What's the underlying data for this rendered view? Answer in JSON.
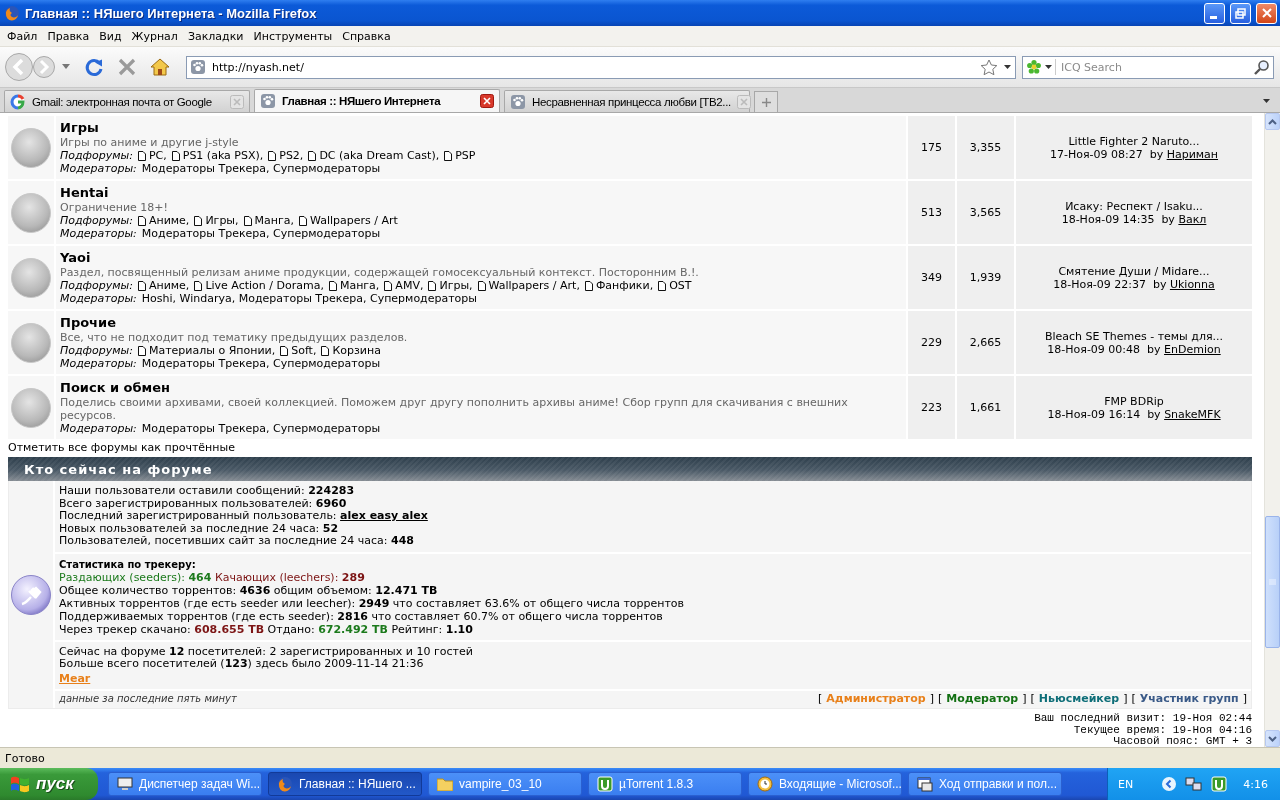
{
  "window": {
    "title": "Главная :: НЯшего Интернета - Mozilla Firefox"
  },
  "menu": [
    "Файл",
    "Правка",
    "Вид",
    "Журнал",
    "Закладки",
    "Инструменты",
    "Справка"
  ],
  "address_bar": {
    "value": "http://nyash.net/"
  },
  "search_bar": {
    "placeholder": "ICQ Search"
  },
  "tabs": [
    {
      "label": "Gmail: электронная почта от Google",
      "selected": false,
      "kind": "google"
    },
    {
      "label": "Главная :: НЯшего Интернета",
      "selected": true,
      "kind": "site"
    },
    {
      "label": "Несравненная принцесса любви [TB2...",
      "selected": false,
      "kind": "site"
    }
  ],
  "forums": [
    {
      "title": "Игры",
      "description": "Игры по аниме и другие j-style",
      "subforums_label": "Подфорумы:",
      "subforums": [
        "PC,",
        "PS1 (aka PSX),",
        "PS2,",
        "DC (aka Dream Cast),",
        "PSP"
      ],
      "moderators_label": "Модераторы:",
      "moderators": "Модераторы Трекера, Супермодераторы",
      "topics": "175",
      "posts": "3,355",
      "last_post": {
        "title": "Little Fighter 2 Naruto...",
        "date": "17-Ноя-09 08:27",
        "by": "by",
        "author": "Нариман"
      }
    },
    {
      "title": "Hentai",
      "description": "Ограничение 18+!",
      "subforums_label": "Подфорумы:",
      "subforums": [
        "Аниме,",
        "Игры,",
        "Манга,",
        "Wallpapers / Art"
      ],
      "moderators_label": "Модераторы:",
      "moderators": "Модераторы Трекера, Супермодераторы",
      "topics": "513",
      "posts": "3,565",
      "last_post": {
        "title": "Исаку: Респект / Isaku...",
        "date": "18-Ноя-09 14:35",
        "by": "by",
        "author": "Вакл"
      }
    },
    {
      "title": "Yaoi",
      "description": "Раздел, посвященный релизам аниме продукции, содержащей гомосексуальный контекст. Посторонним В.!.",
      "subforums_label": "Подфорумы:",
      "subforums": [
        "Аниме,",
        "Live Action / Dorama,",
        "Манга,",
        "AMV,",
        "Игры,",
        "Wallpapers / Art,",
        "Фанфики,",
        "OST"
      ],
      "moderators_label": "Модераторы:",
      "moderators": "Hoshi, Windarya, Модераторы Трекера, Супермодераторы",
      "topics": "349",
      "posts": "1,939",
      "last_post": {
        "title": "Смятение Души / Midare...",
        "date": "18-Ноя-09 22:37",
        "by": "by",
        "author": "Ukionna"
      }
    },
    {
      "title": "Прочие",
      "description": "Все, что не подходит под тематику предыдущих разделов.",
      "subforums_label": "Подфорумы:",
      "subforums": [
        "Материалы о Японии,",
        "Soft,",
        "Корзина"
      ],
      "moderators_label": "Модераторы:",
      "moderators": "Модераторы Трекера, Супермодераторы",
      "topics": "229",
      "posts": "2,665",
      "last_post": {
        "title": "Bleach SE Themes - темы для...",
        "date": "18-Ноя-09 00:48",
        "by": "by",
        "author": "EnDemion"
      }
    },
    {
      "title": "Поиск и обмен",
      "description": "Поделись своими архивами, своей коллекцией. Поможем друг другу пополнить архивы аниме! Сбор групп для скачивания с внешних ресурсов.",
      "moderators_label": "Модераторы:",
      "moderators": "Модераторы Трекера, Супермодераторы",
      "topics": "223",
      "posts": "1,661",
      "last_post": {
        "title": "FMP BDRip",
        "date": "18-Ноя-09 16:14",
        "by": "by",
        "author": "SnakeMFK"
      }
    }
  ],
  "mark_all_read": "Отметить все форумы как прочтённые",
  "online": {
    "header": "Кто сейчас на форуме",
    "board_stats": [
      [
        {
          "kind": "plain",
          "text": "Наши пользователи оставили сообщений: **224283**"
        }
      ],
      [
        {
          "kind": "plain",
          "text": "Всего зарегистрированных пользователей: **6960**"
        }
      ],
      [
        {
          "kind": "plain",
          "text": "Последний зарегистрированный пользователь:"
        },
        {
          "kind": "link",
          "text": "alex easy alex"
        }
      ],
      [
        {
          "kind": "plain",
          "text": "Новых пользователей за последние 24 часа: **52**"
        }
      ],
      [
        {
          "kind": "plain",
          "text": "Пользователей, посетивших сайт за последние 24 часа: **448**"
        }
      ]
    ],
    "tracker_title": "Статистика по трекеру:",
    "tracker_stats": [
      [
        {
          "kind": "seeders",
          "text": "Раздающих (seeders): **464**"
        },
        {
          "kind": "leechers",
          "text": "Качающих (leechers): **289**"
        }
      ],
      [
        {
          "kind": "plain",
          "text": "Общее количество торрентов: **4636** общим объемом: **12.471 TB**"
        }
      ],
      [
        {
          "kind": "plain",
          "text": "Активных торрентов (где есть seeder или leecher): **2949** что составляет 63.6% от общего числа торрентов"
        }
      ],
      [
        {
          "kind": "plain",
          "text": "Поддерживаемых торрентов (где есть seeder): **2816** что составляет 60.7% от общего числа торрентов"
        }
      ],
      [
        {
          "kind": "plain",
          "text": "Через трекер скачано:"
        },
        {
          "kind": "leechers",
          "text": "**608.655 TB**"
        },
        {
          "kind": "plain",
          "text": "Отдано:"
        },
        {
          "kind": "seeders",
          "text": "**672.492 TB**"
        },
        {
          "kind": "plain",
          "text": "Рейтинг: **1.10**"
        }
      ]
    ],
    "visitors": [
      "Сейчас на форуме **12** посетителей: 2 зарегистрированных и 10 гостей",
      "Больше всего посетителей (**123**) здесь было 2009-11-14 21:36"
    ],
    "users": [
      {
        "name": "Mear",
        "color": "#e8801a"
      }
    ],
    "note": "данные за последние пять минут",
    "legend": [
      {
        "open": "[",
        "label": "Администратор",
        "close": "]",
        "color": "#e8801a"
      },
      {
        "open": "[",
        "label": "Модератор",
        "close": "]",
        "color": "#127012"
      },
      {
        "open": "[",
        "label": "Ньюсмейкер",
        "close": "]",
        "color": "#0e6e78"
      },
      {
        "open": "[",
        "label": "Участник групп",
        "close": "]",
        "color": "#3a5a88"
      }
    ]
  },
  "time_info": [
    "Ваш последний визит: 19-Ноя 02:44",
    "Текущее время: 19-Ноя 04:16",
    "Часовой пояс: GMT + 3"
  ],
  "status_bar": {
    "text": "Готово"
  },
  "taskbar": {
    "start": "пуск",
    "tasks": [
      {
        "label": "Диспетчер задач Wi...",
        "selected": false,
        "kind": "monitor"
      },
      {
        "label": "Главная :: НЯшего ...",
        "selected": true,
        "kind": "firefox"
      },
      {
        "label": "vampire_03_10",
        "selected": false,
        "kind": "folder"
      },
      {
        "label": "µTorrent 1.8.3",
        "selected": false,
        "kind": "utorrent"
      },
      {
        "label": "Входящие - Microsof...",
        "selected": false,
        "kind": "clock"
      },
      {
        "label": "Ход отправки и пол...",
        "selected": false,
        "kind": "window"
      }
    ],
    "language": "EN",
    "clock": "4:16"
  }
}
